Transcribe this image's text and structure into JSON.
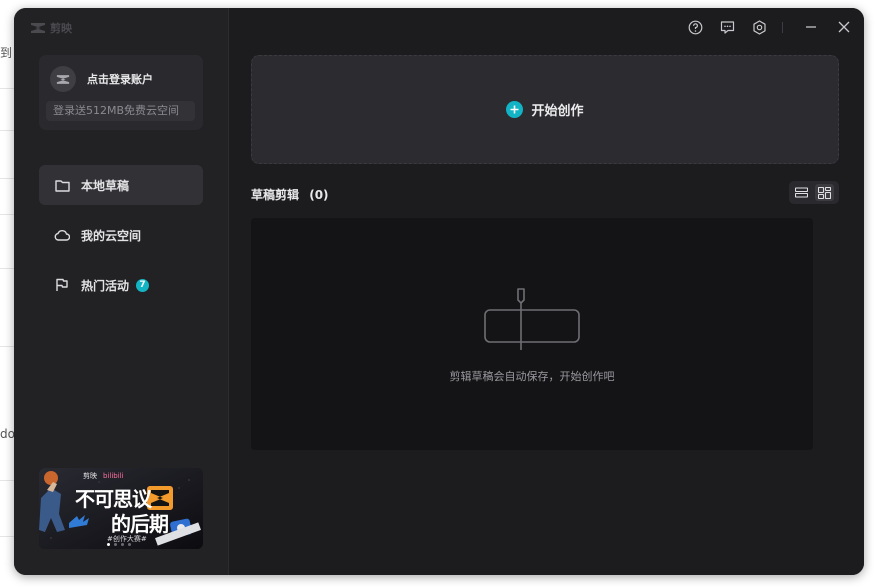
{
  "background": {
    "fragments": [
      "到",
      "do"
    ]
  },
  "app": {
    "logo_text": "剪映"
  },
  "login": {
    "label": "点击登录账户",
    "promo": "登录送512MB免费云空间"
  },
  "sidebar": {
    "items": [
      {
        "label": "本地草稿",
        "icon": "folder-icon",
        "active": true
      },
      {
        "label": "我的云空间",
        "icon": "cloud-icon",
        "active": false
      },
      {
        "label": "热门活动",
        "icon": "flag-icon",
        "active": false,
        "badge": "7"
      }
    ]
  },
  "banner": {
    "brand": "剪映",
    "partner": "bilibili",
    "headline_1": "不可思议",
    "headline_2": "的后期",
    "caption": "#创作大赛#"
  },
  "toolbar": {
    "icons": [
      "help-icon",
      "feedback-icon",
      "settings-icon",
      "minimize-icon",
      "close-icon"
    ]
  },
  "main": {
    "create_label": "开始创作",
    "drafts_title": "草稿剪辑",
    "drafts_count": "(0)",
    "empty_text": "剪辑草稿会自动保存，开始创作吧"
  },
  "colors": {
    "accent": "#11b3c4",
    "window_bg": "#1c1c1f",
    "sidebar_bg": "#222225"
  }
}
